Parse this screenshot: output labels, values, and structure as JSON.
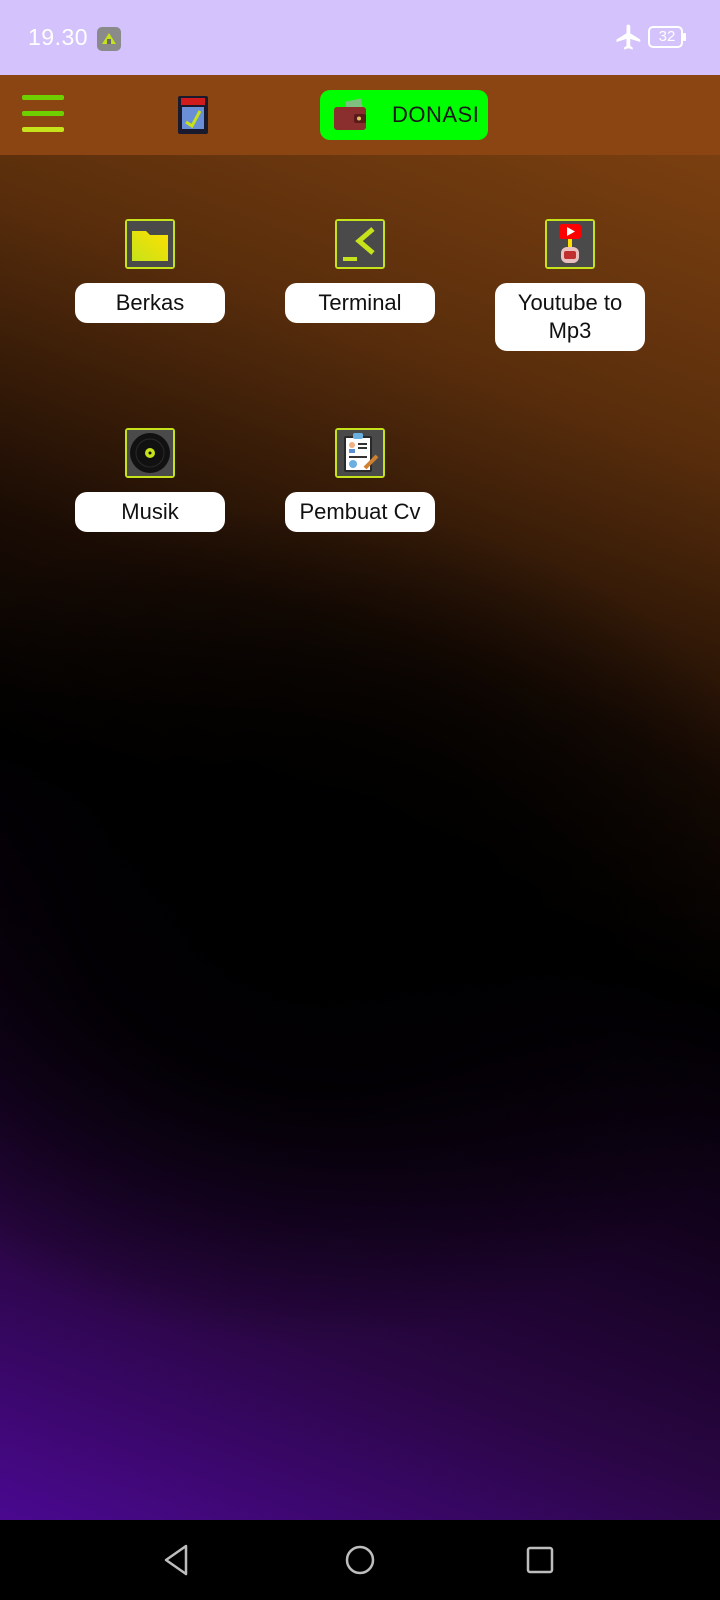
{
  "status_bar": {
    "time": "19.30",
    "battery_level": "32",
    "icons": [
      "app-notification-icon",
      "airplane-mode-icon",
      "battery-icon"
    ]
  },
  "app_bar": {
    "menu_icon": "hamburger-menu-icon",
    "storage_icon": "sd-card-icon",
    "donate_label": "DONASI",
    "donate_icon": "wallet-icon",
    "colors": {
      "bar": "#8b4513",
      "donate_bg": "#00ff00",
      "menu_green": "#6fd000",
      "menu_yellow": "#c6e21a"
    }
  },
  "apps": [
    {
      "label": "Berkas",
      "icon": "folder-icon"
    },
    {
      "label": "Terminal",
      "icon": "terminal-icon"
    },
    {
      "label": "Youtube to Mp3",
      "icon": "youtube-mp3-icon"
    },
    {
      "label": "Musik",
      "icon": "vinyl-record-icon"
    },
    {
      "label": "Pembuat Cv",
      "icon": "cv-clipboard-icon"
    }
  ],
  "nav_bar": {
    "buttons": [
      "back-icon",
      "home-icon",
      "recents-icon"
    ]
  }
}
